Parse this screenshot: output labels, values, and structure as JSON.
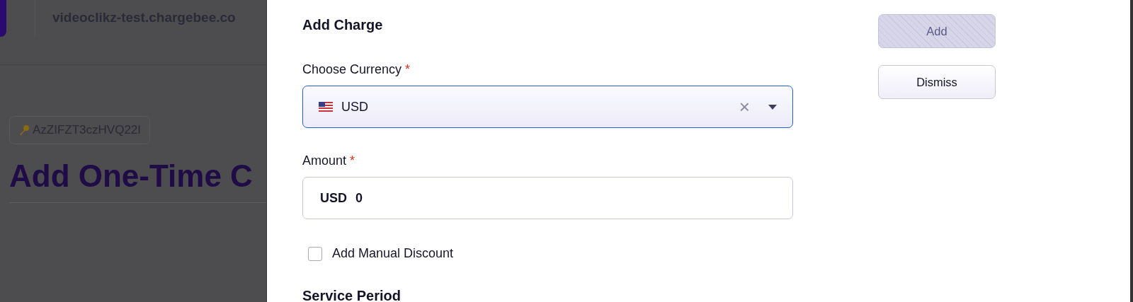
{
  "background_page": {
    "host": "videoclikz-test.chargebee.co",
    "key_chip": "AzZIFZT3czHVQ22I",
    "heading": "Add One-Time C"
  },
  "modal": {
    "title": "Add Charge",
    "fields": [
      {
        "kind": "select",
        "label": "Choose Currency",
        "required_mark": "*",
        "value": "USD",
        "focused": true,
        "clear": "×"
      },
      {
        "kind": "amount",
        "label": "Amount",
        "required_mark": "*",
        "prefix": "USD",
        "value": "0",
        "focused": false
      }
    ],
    "checkbox": {
      "label": "Add Manual Discount",
      "checked": false
    },
    "section_heading": "Service Period",
    "buttons": [
      {
        "label": "Add",
        "disabled": true
      },
      {
        "label": "Dismiss",
        "disabled": false
      }
    ]
  }
}
